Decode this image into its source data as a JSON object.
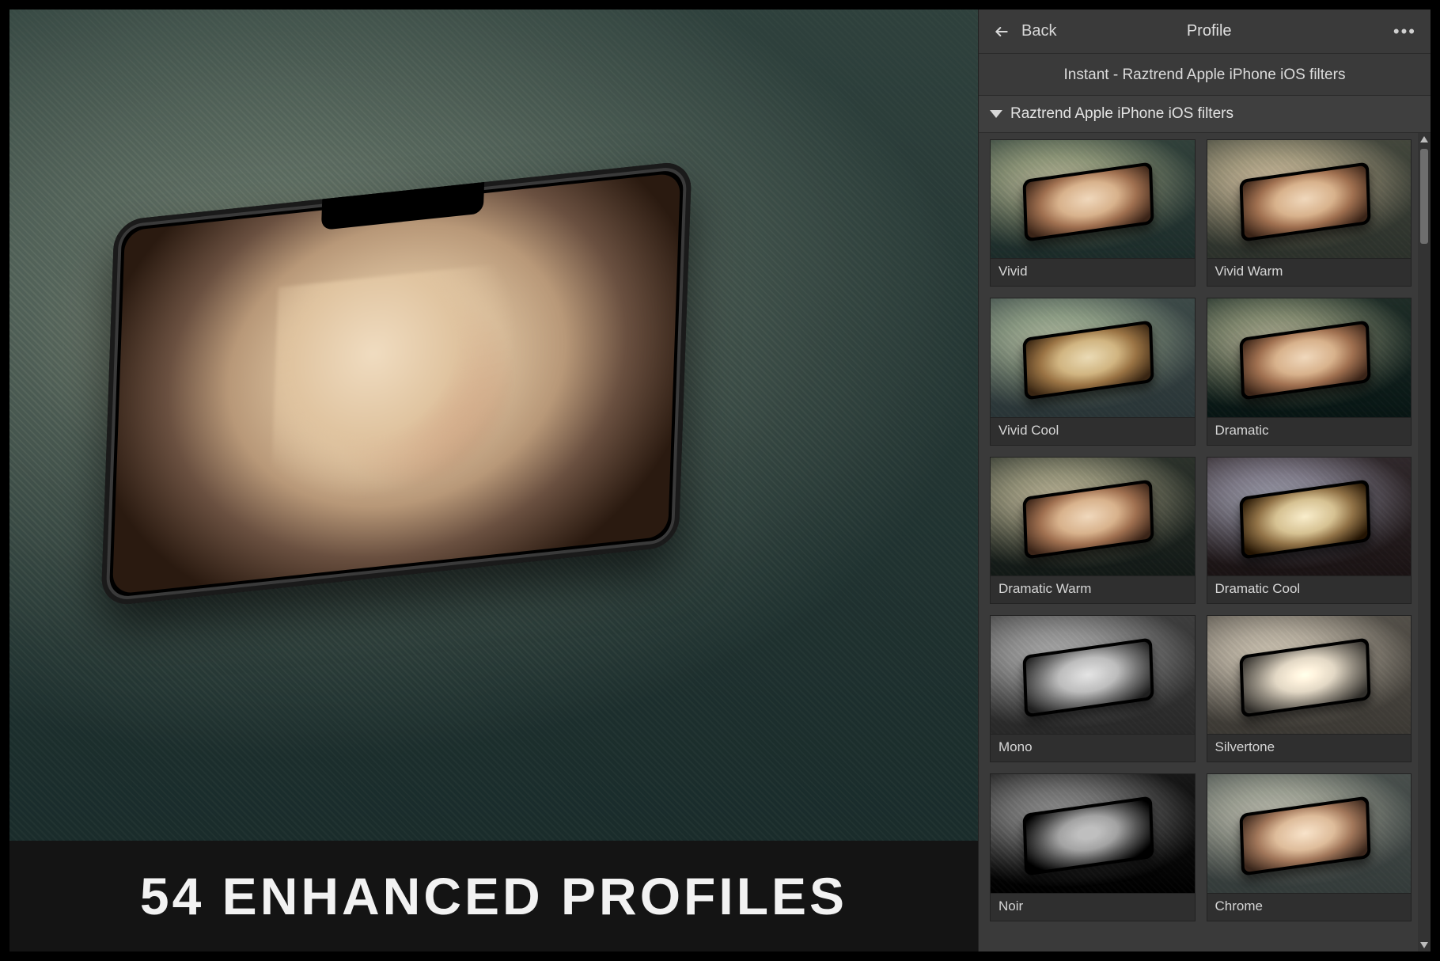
{
  "banner": {
    "text": "54 Enhanced Profiles"
  },
  "panel": {
    "back_label": "Back",
    "title": "Profile",
    "current_preset": "Instant - Raztrend Apple iPhone iOS filters",
    "group_name": "Raztrend Apple iPhone iOS filters",
    "filters": [
      {
        "label": "Vivid",
        "tint": "vivid"
      },
      {
        "label": "Vivid Warm",
        "tint": "vivid-warm"
      },
      {
        "label": "Vivid Cool",
        "tint": "vivid-cool"
      },
      {
        "label": "Dramatic",
        "tint": "dramatic"
      },
      {
        "label": "Dramatic Warm",
        "tint": "dramatic-warm"
      },
      {
        "label": "Dramatic Cool",
        "tint": "dramatic-cool"
      },
      {
        "label": "Mono",
        "tint": "mono"
      },
      {
        "label": "Silvertone",
        "tint": "silvertone"
      },
      {
        "label": "Noir",
        "tint": "noir"
      },
      {
        "label": "Chrome",
        "tint": "chrome"
      }
    ]
  }
}
